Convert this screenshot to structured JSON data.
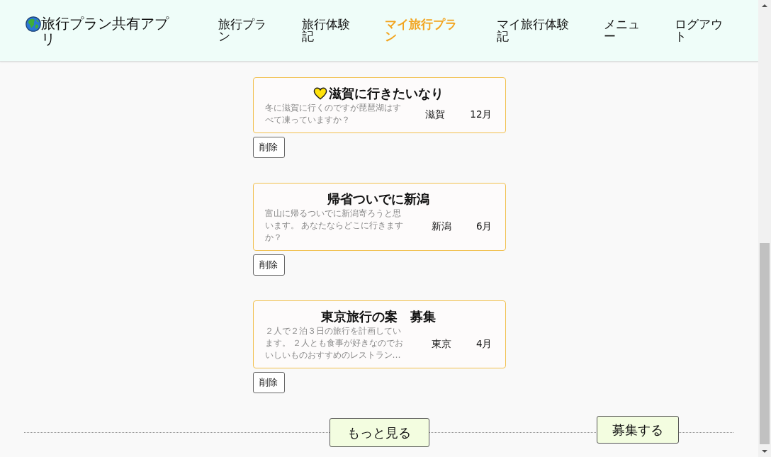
{
  "header": {
    "app_title": "旅行プラン共有アプリ",
    "nav": [
      {
        "label": "旅行プラン",
        "selected": false
      },
      {
        "label": "旅行体験記",
        "selected": false
      },
      {
        "label": "マイ旅行プラン",
        "selected": true
      },
      {
        "label": "マイ旅行体験記",
        "selected": false
      },
      {
        "label": "メニュー",
        "selected": false
      },
      {
        "label": "ログアウト",
        "selected": false
      }
    ]
  },
  "plans": [
    {
      "title": "滋賀に行きたいなり",
      "favorite": true,
      "description": "冬に滋賀に行くのですが琵琶湖はすべて凍っていますか？",
      "place": "滋賀",
      "month": "12月",
      "delete_label": "削除"
    },
    {
      "title": "帰省ついでに新潟",
      "favorite": false,
      "description": "富山に帰るついでに新潟寄ろうと思います。 あなたならどこに行きますか？",
      "place": "新潟",
      "month": "6月",
      "delete_label": "削除"
    },
    {
      "title": "東京旅行の案　募集",
      "favorite": false,
      "description": "２人で２泊３日の旅行を計画しています。 ２人とも食事が好きなのでおいしいものおすすめのレストラン…",
      "place": "東京",
      "month": "4月",
      "delete_label": "削除"
    }
  ],
  "footer": {
    "more_label": "もっと見る",
    "recruit_label": "募集する"
  }
}
